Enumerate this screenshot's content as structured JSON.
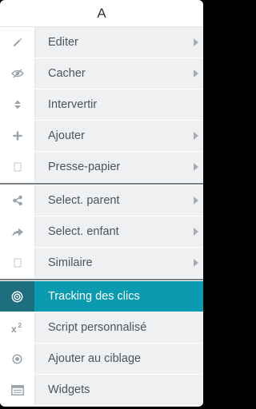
{
  "header": {
    "title": "A"
  },
  "menu": {
    "items": [
      {
        "label": "Editer",
        "icon": "pencil-icon",
        "submenu": true
      },
      {
        "label": "Cacher",
        "icon": "eye-slash-icon",
        "submenu": true
      },
      {
        "label": "Intervertir",
        "icon": "sort-icon",
        "submenu": false
      },
      {
        "label": "Ajouter",
        "icon": "plus-icon",
        "submenu": true
      },
      {
        "label": "Presse-papier",
        "icon": "clipboard-icon",
        "submenu": true
      },
      {
        "label": "Select. parent",
        "icon": "share-icon",
        "submenu": true
      },
      {
        "label": "Select. enfant",
        "icon": "redo-arrow-icon",
        "submenu": true
      },
      {
        "label": "Similaire",
        "icon": "similar-icon",
        "submenu": true
      },
      {
        "label": "Tracking des clics",
        "icon": "target-icon",
        "submenu": false,
        "active": true
      },
      {
        "label": "Script personnalisé",
        "icon": "superscript-icon",
        "submenu": false
      },
      {
        "label": "Ajouter au ciblage",
        "icon": "dot-circle-icon",
        "submenu": false
      },
      {
        "label": "Widgets",
        "icon": "widgets-icon",
        "submenu": false
      }
    ]
  },
  "colors": {
    "active_bg": "#0b9bb1",
    "active_icon_bg": "#1e6e7f",
    "item_bg": "#eef0f2",
    "icon_color": "#9ba3ab"
  }
}
